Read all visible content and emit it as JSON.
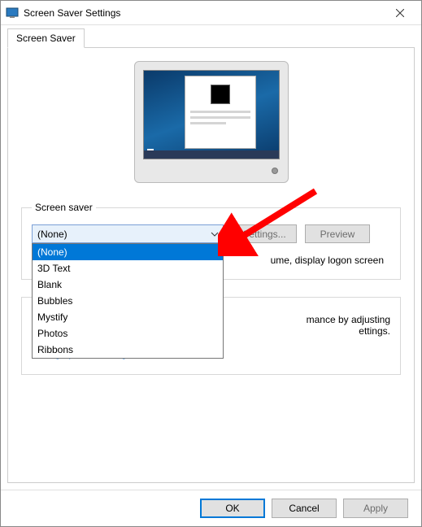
{
  "title": "Screen Saver Settings",
  "tab": "Screen Saver",
  "group_screensaver": {
    "legend": "Screen saver",
    "selected": "(None)",
    "options": [
      "(None)",
      "3D Text",
      "Blank",
      "Bubbles",
      "Mystify",
      "Photos",
      "Ribbons"
    ],
    "settings_btn": "Settings...",
    "preview_btn": "Preview",
    "resume_text": "ume, display logon screen"
  },
  "group_power": {
    "desc_line1": "mance by adjusting",
    "desc_line2": "ettings.",
    "link": "Change power settings"
  },
  "buttons": {
    "ok": "OK",
    "cancel": "Cancel",
    "apply": "Apply"
  }
}
